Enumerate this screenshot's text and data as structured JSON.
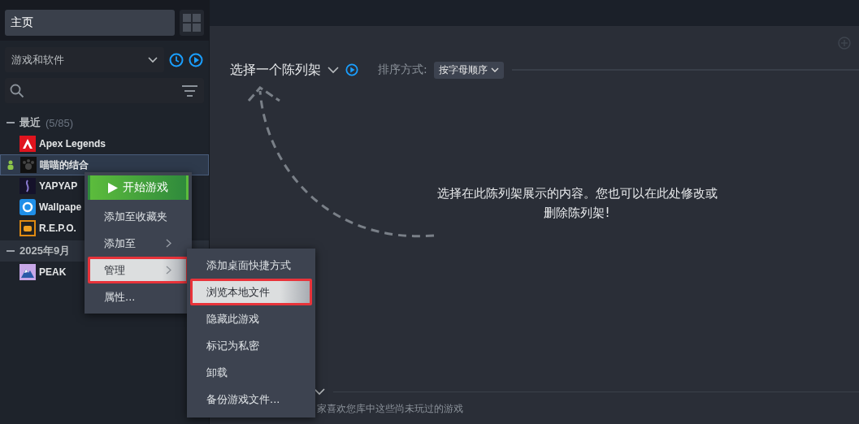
{
  "sidebar": {
    "home": {
      "label": "主页"
    },
    "filter": {
      "value": "游戏和软件"
    },
    "sections": [
      {
        "title": "最近",
        "count": "(5/85)",
        "expanded": true,
        "items": [
          {
            "name": "Apex Legends",
            "selected": false,
            "friends_playing": false
          },
          {
            "name": "喵喵的结合",
            "selected": true,
            "friends_playing": true
          },
          {
            "name": "YAPYAP",
            "selected": false,
            "friends_playing": false
          },
          {
            "name": "Wallpape",
            "selected": false,
            "friends_playing": false
          },
          {
            "name": "R.E.P.O.",
            "selected": false,
            "friends_playing": false
          }
        ]
      },
      {
        "title": "2025年9月",
        "expanded": true,
        "items": [
          {
            "name": "PEAK",
            "selected": false,
            "friends_playing": false
          }
        ]
      }
    ]
  },
  "shelf": {
    "title": "选择一个陈列架",
    "sort_label": "排序方式:",
    "sort_value": "按字母顺序",
    "message": "选择在此陈列架展示的内容。您也可以在此处修改或删除陈列架!",
    "footer": "家喜欢您库中这些尚未玩过的游戏"
  },
  "context_menu": {
    "items": [
      {
        "kind": "primary",
        "label": "开始游戏",
        "submenu": false,
        "highlighted": false,
        "marked": false
      },
      {
        "kind": "item",
        "label": "添加至收藏夹",
        "submenu": false,
        "highlighted": false,
        "marked": false
      },
      {
        "kind": "item",
        "label": "添加至",
        "submenu": true,
        "highlighted": false,
        "marked": false
      },
      {
        "kind": "item",
        "label": "管理",
        "submenu": true,
        "highlighted": true,
        "marked": true
      },
      {
        "kind": "item",
        "label": "属性...",
        "submenu": false,
        "highlighted": false,
        "marked": false
      }
    ]
  },
  "submenu": {
    "items": [
      {
        "label": "添加桌面快捷方式",
        "highlighted": false,
        "marked": false
      },
      {
        "label": "浏览本地文件",
        "highlighted": true,
        "marked": true
      },
      {
        "label": "隐藏此游戏",
        "highlighted": false,
        "marked": false
      },
      {
        "label": "标记为私密",
        "highlighted": false,
        "marked": false
      },
      {
        "label": "卸载",
        "highlighted": false,
        "marked": false
      },
      {
        "label": "备份游戏文件...",
        "highlighted": false,
        "marked": false
      }
    ]
  }
}
